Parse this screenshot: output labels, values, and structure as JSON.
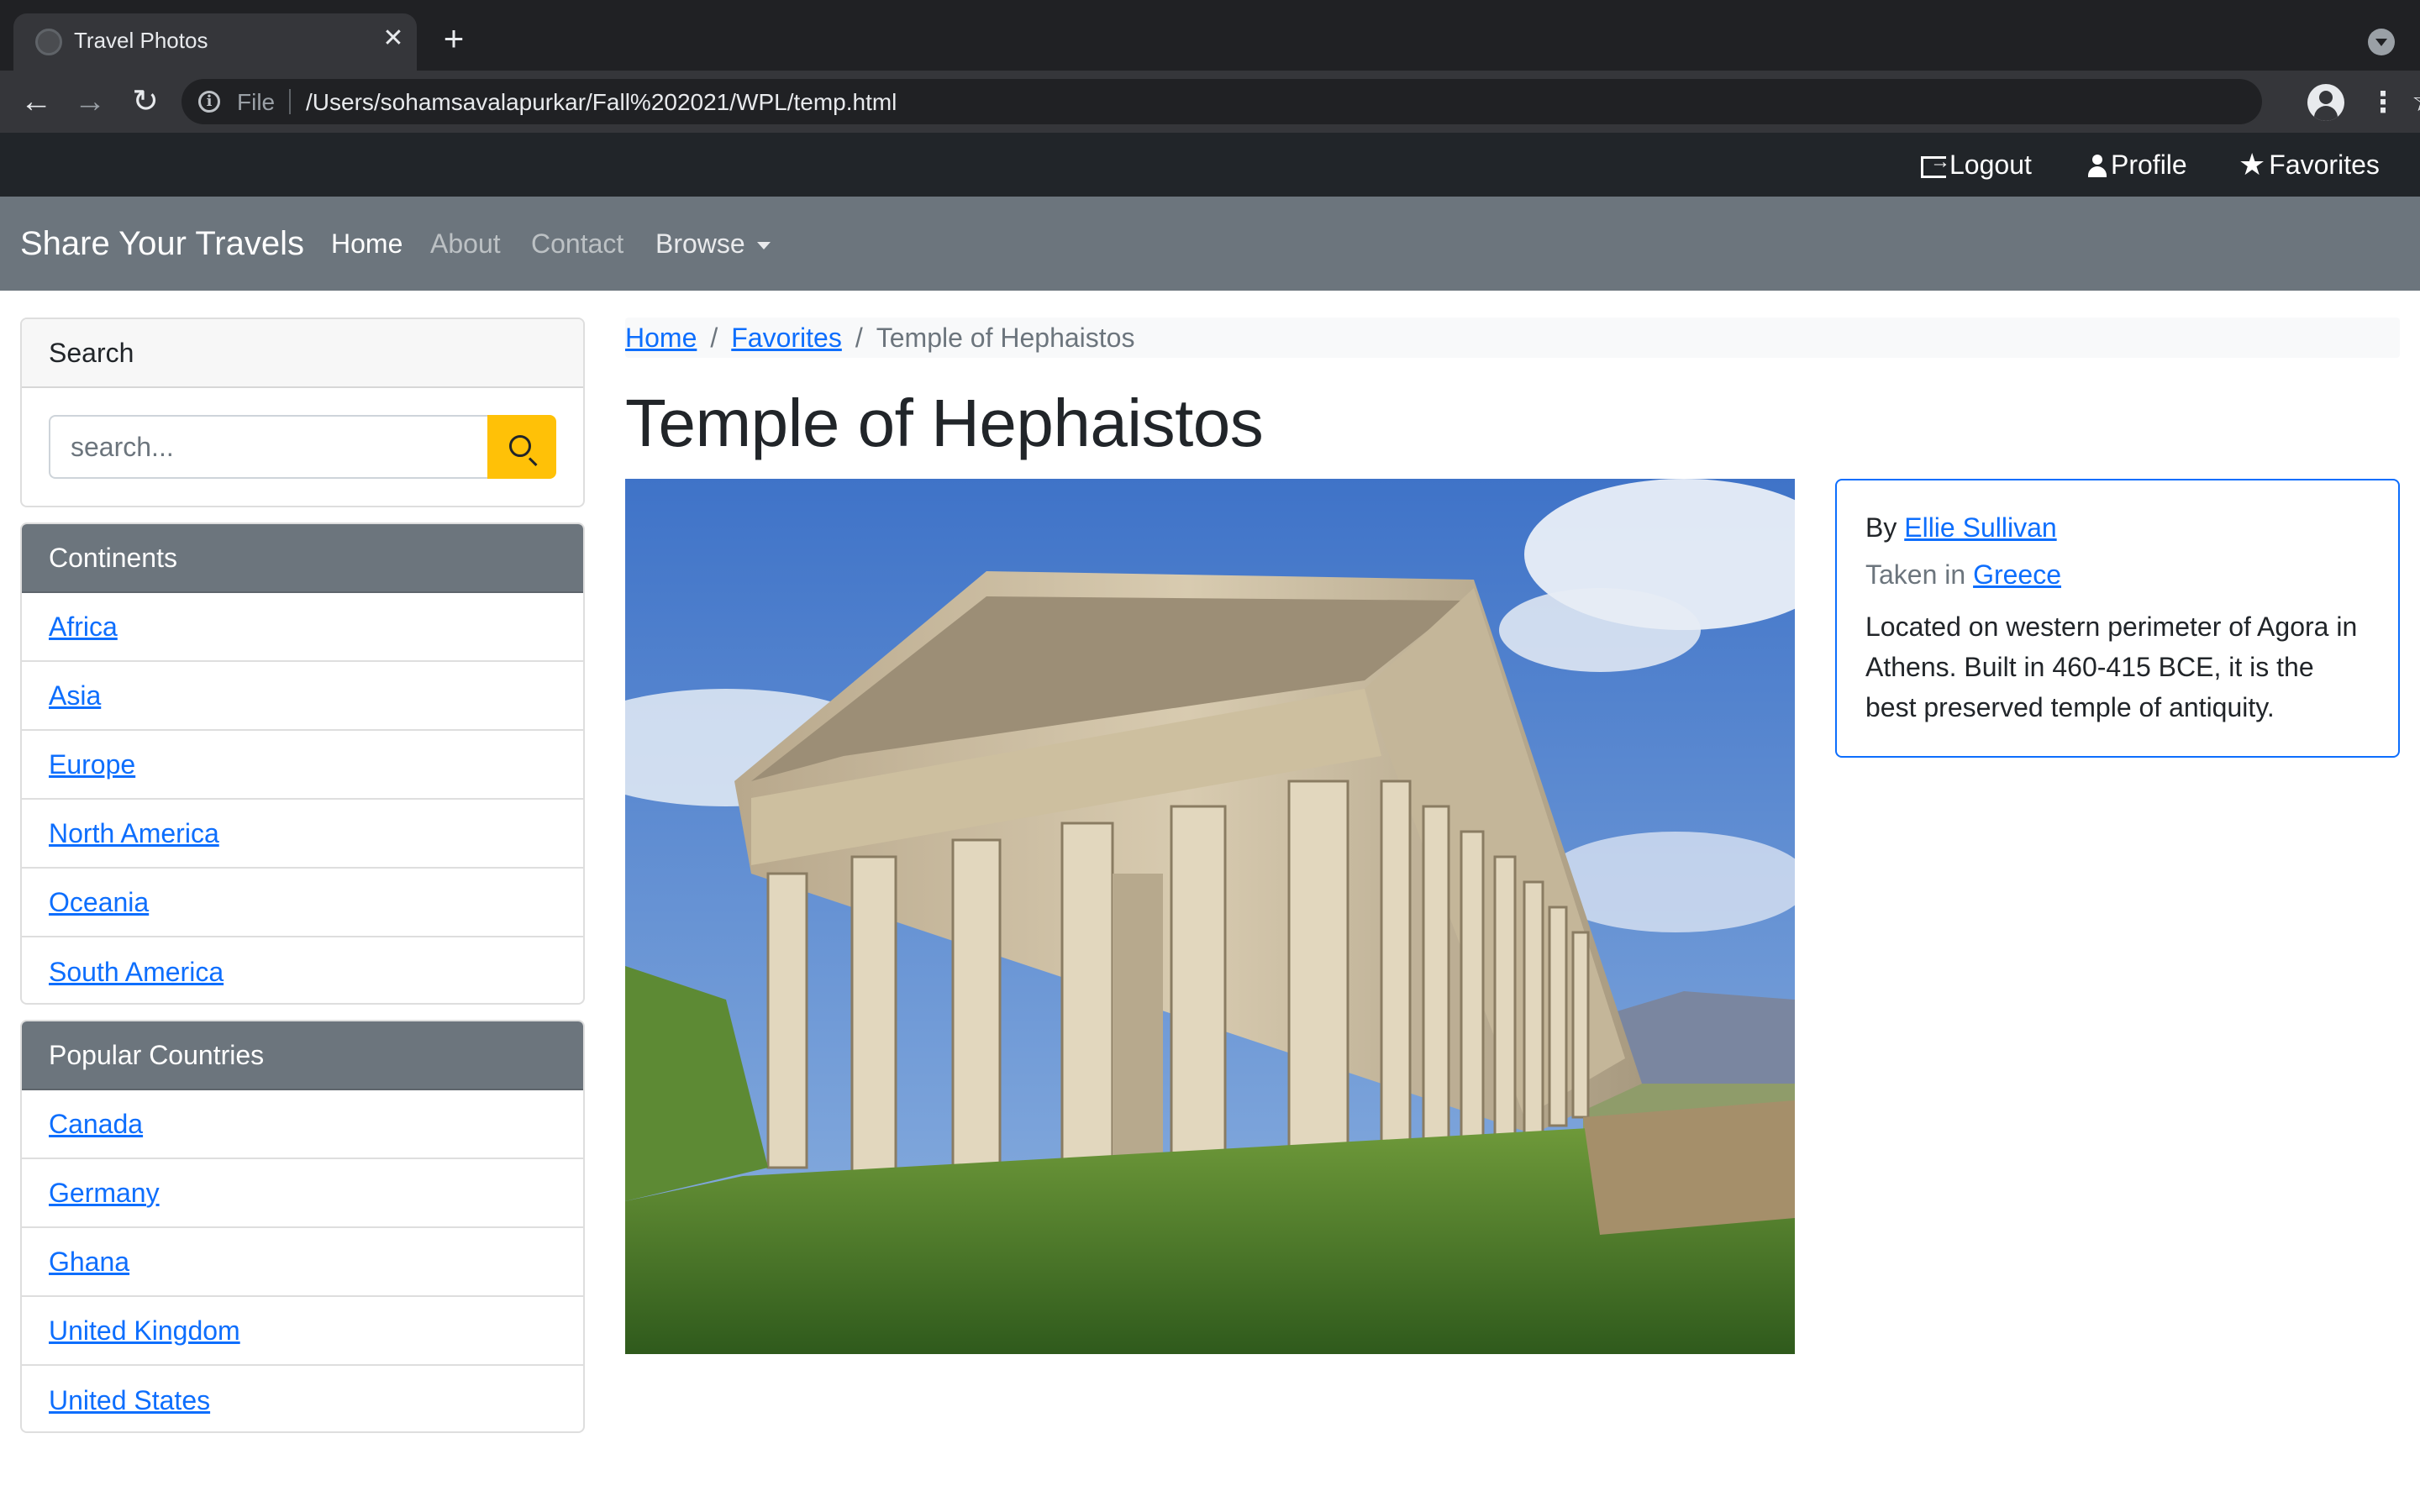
{
  "browser": {
    "tab_title": "Travel Photos",
    "url_scheme": "File",
    "url": "/Users/sohamsavalapurkar/Fall%202021/WPL/temp.html"
  },
  "topbar": {
    "logout": "Logout",
    "profile": "Profile",
    "favorites": "Favorites"
  },
  "navbar": {
    "brand": "Share Your Travels",
    "links": [
      "Home",
      "About",
      "Contact",
      "Browse"
    ]
  },
  "sidebar": {
    "search": {
      "title": "Search",
      "placeholder": "search..."
    },
    "continents": {
      "title": "Continents",
      "items": [
        "Africa",
        "Asia",
        "Europe",
        "North America",
        "Oceania",
        "South America"
      ]
    },
    "countries": {
      "title": "Popular Countries",
      "items": [
        "Canada",
        "Germany",
        "Ghana",
        "United Kingdom",
        "United States"
      ]
    }
  },
  "breadcrumb": {
    "items": [
      "Home",
      "Favorites"
    ],
    "current": "Temple of Hephaistos",
    "separator": "/"
  },
  "photo": {
    "title": "Temple of Hephaistos",
    "by_label": "By",
    "author": "Ellie Sullivan",
    "taken_label": "Taken in",
    "country": "Greece",
    "description": "Located on western perimeter of Agora in Athens. Built in 460-415 BCE, it is the best preserved temple of antiquity."
  },
  "colors": {
    "link": "#0d6efd",
    "navbar": "#6c757d",
    "topbar": "#212529",
    "search_button": "#ffc107"
  }
}
